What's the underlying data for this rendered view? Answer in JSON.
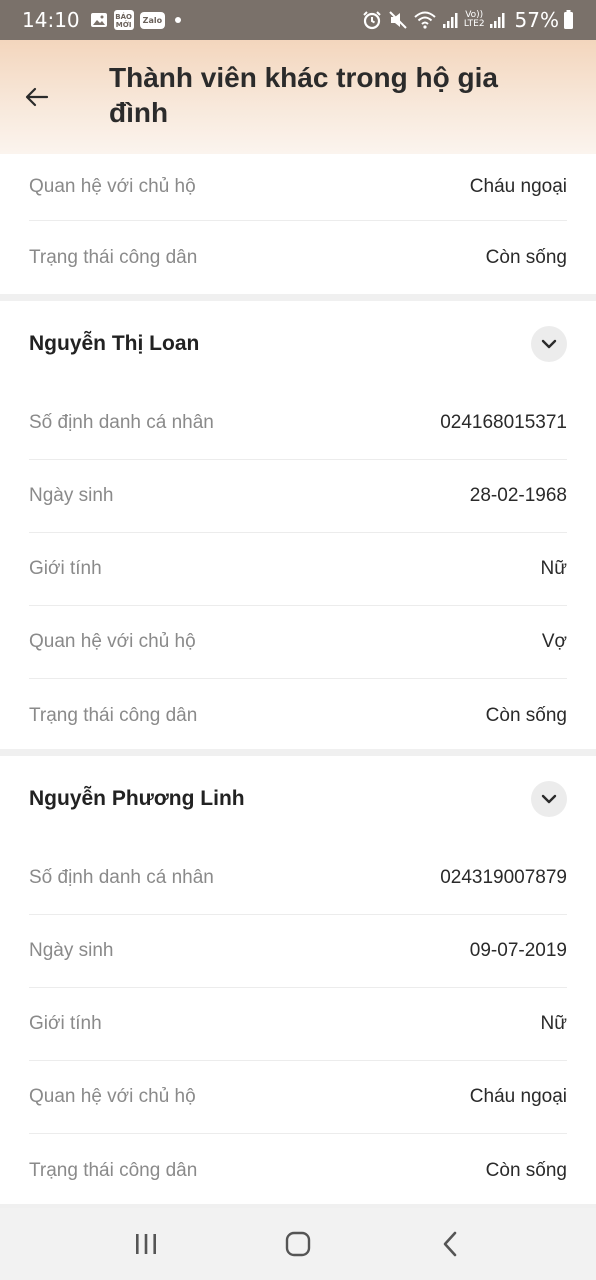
{
  "status_bar": {
    "time": "14:10",
    "app_badges": [
      "BÁO MỚI",
      "Zalo"
    ],
    "network": "LTE2",
    "battery": "57%"
  },
  "header": {
    "title": "Thành viên khác trong hộ gia đình"
  },
  "partial_member": {
    "rows": [
      {
        "label": "Quan hệ với chủ hộ",
        "value": "Cháu ngoại"
      },
      {
        "label": "Trạng thái công dân",
        "value": "Còn sống"
      }
    ]
  },
  "members": [
    {
      "name": "Nguyễn Thị Loan",
      "rows": [
        {
          "label": "Số định danh cá nhân",
          "value": "024168015371"
        },
        {
          "label": "Ngày sinh",
          "value": "28-02-1968"
        },
        {
          "label": "Giới tính",
          "value": "Nữ"
        },
        {
          "label": "Quan hệ với chủ hộ",
          "value": "Vợ"
        },
        {
          "label": "Trạng thái công dân",
          "value": "Còn sống"
        }
      ]
    },
    {
      "name": "Nguyễn Phương Linh",
      "rows": [
        {
          "label": "Số định danh cá nhân",
          "value": "024319007879"
        },
        {
          "label": "Ngày sinh",
          "value": "09-07-2019"
        },
        {
          "label": "Giới tính",
          "value": "Nữ"
        },
        {
          "label": "Quan hệ với chủ hộ",
          "value": "Cháu ngoại"
        },
        {
          "label": "Trạng thái công dân",
          "value": "Còn sống"
        }
      ]
    }
  ],
  "icons": {
    "back": "arrow-left-icon",
    "expand": "chevron-down-icon",
    "nav": [
      "recents-icon",
      "home-icon",
      "back-icon"
    ]
  }
}
